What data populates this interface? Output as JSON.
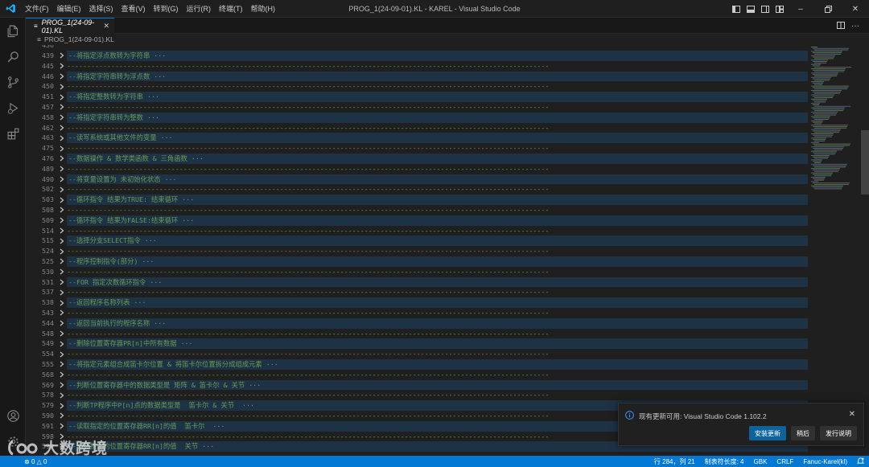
{
  "titlebar": {
    "menu": [
      "文件(F)",
      "编辑(E)",
      "选择(S)",
      "查看(V)",
      "转到(G)",
      "运行(R)",
      "终端(T)",
      "帮助(H)"
    ],
    "title": "PROG_1(24-09-01).KL - KAREL - Visual Studio Code"
  },
  "tab": {
    "label": "PROG_1(24-09-01).KL"
  },
  "breadcrumb": {
    "file": "PROG_1(24-09-01).KL"
  },
  "editor": {
    "top_partial_line": "436",
    "lines": [
      {
        "n": "439",
        "fold": true,
        "text": "--将指定浮点数转为字符串"
      },
      {
        "n": "445",
        "fold": false,
        "text": ""
      },
      {
        "n": "446",
        "fold": true,
        "text": "--将指定字符串转为浮点数"
      },
      {
        "n": "450",
        "fold": false,
        "text": ""
      },
      {
        "n": "451",
        "fold": true,
        "text": "--将指定整数转为字符串"
      },
      {
        "n": "457",
        "fold": false,
        "text": ""
      },
      {
        "n": "458",
        "fold": true,
        "text": "--将指定字符串转为整数"
      },
      {
        "n": "462",
        "fold": false,
        "text": ""
      },
      {
        "n": "463",
        "fold": true,
        "text": "--读写系统或其他文件的变量"
      },
      {
        "n": "475",
        "fold": false,
        "text": ""
      },
      {
        "n": "476",
        "fold": true,
        "text": "--数据操作 & 数学类函数 & 三角函数"
      },
      {
        "n": "489",
        "fold": false,
        "text": ""
      },
      {
        "n": "490",
        "fold": true,
        "text": "--将变量设置为 未初始化状态"
      },
      {
        "n": "502",
        "fold": false,
        "text": ""
      },
      {
        "n": "503",
        "fold": true,
        "text": "--循环指令 结果为TRUE: 结束循环"
      },
      {
        "n": "508",
        "fold": false,
        "text": ""
      },
      {
        "n": "509",
        "fold": true,
        "text": "--循环指令 结果为FALSE:结束循环"
      },
      {
        "n": "514",
        "fold": false,
        "text": ""
      },
      {
        "n": "515",
        "fold": true,
        "text": "--选择分支SELECT指令"
      },
      {
        "n": "524",
        "fold": false,
        "text": ""
      },
      {
        "n": "525",
        "fold": true,
        "text": "--程序控制指令(部分)"
      },
      {
        "n": "530",
        "fold": false,
        "text": ""
      },
      {
        "n": "531",
        "fold": true,
        "text": "--FOR 指定次数循环指令"
      },
      {
        "n": "537",
        "fold": false,
        "text": ""
      },
      {
        "n": "538",
        "fold": true,
        "text": "--返回程序名称列表"
      },
      {
        "n": "543",
        "fold": false,
        "text": ""
      },
      {
        "n": "544",
        "fold": true,
        "text": "--返回当前执行的程序名称"
      },
      {
        "n": "548",
        "fold": false,
        "text": ""
      },
      {
        "n": "549",
        "fold": true,
        "text": "--删除位置寄存器PR[n]中所有数据"
      },
      {
        "n": "554",
        "fold": false,
        "text": ""
      },
      {
        "n": "555",
        "fold": true,
        "text": "--将指定元素组合成笛卡尔位置 & 将笛卡尔位置拆分成组成元素"
      },
      {
        "n": "568",
        "fold": false,
        "text": ""
      },
      {
        "n": "569",
        "fold": true,
        "text": "--判断位置寄存器中的数据类型是 矩阵 & 笛卡尔 & 关节"
      },
      {
        "n": "578",
        "fold": false,
        "text": ""
      },
      {
        "n": "579",
        "fold": true,
        "text": "--判断TP程序中P[n]点的数据类型是  笛卡尔 & 关节 "
      },
      {
        "n": "590",
        "fold": false,
        "text": ""
      },
      {
        "n": "591",
        "fold": true,
        "text": "--读取指定的位置寄存器RR[n]的值  笛卡尔 "
      },
      {
        "n": "598",
        "fold": false,
        "text": ""
      },
      {
        "n": "599",
        "fold": true,
        "text": "--读取指定的位置寄存器RR[n]的值  关节"
      }
    ],
    "ellipsis": "···",
    "dash_text": "------------------------------------------------------------------------------------------------------------------------"
  },
  "notification": {
    "message": "现有更新可用: Visual Studio Code 1.102.2",
    "buttons": {
      "install": "安装更新",
      "later": "稍后",
      "notes": "发行说明"
    }
  },
  "statusbar": {
    "errors": "0",
    "warnings": "0",
    "position": "行 284，列 21",
    "tab_size": "制表符长度: 4",
    "encoding": "GBK",
    "eol": "CRLF",
    "language": "Fanuc-Karel(kl)"
  },
  "watermark": {
    "text": "大数跨境"
  },
  "colors": {
    "accent": "#0078d4",
    "comment": "#6a9955",
    "fold_bg": "#1e3246",
    "editor_bg": "#1f1f1f"
  }
}
